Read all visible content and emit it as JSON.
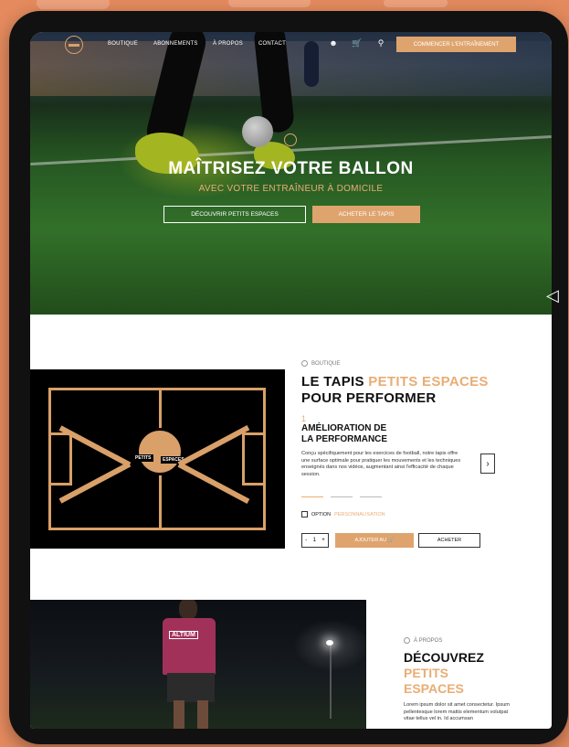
{
  "nav": {
    "links": [
      "BOUTIQUE",
      "ABONNEMENTS",
      "À PROPOS",
      "CONTACT"
    ],
    "cta": "COMMENCER L'ENTRAÎNEMENT",
    "icons": [
      "user-icon",
      "cart-icon",
      "search-icon"
    ]
  },
  "hero": {
    "title": "MAÎTRISEZ VOTRE BALLON",
    "subtitle": "AVEC VOTRE ENTRAÎNEUR À DOMICILE",
    "btn_discover": "DÉCOUVRIR PETITS ESPACES",
    "btn_buy": "ACHETER LE TAPIS"
  },
  "product": {
    "eyebrow": "BOUTIQUE",
    "title_part1": "LE TAPIS ",
    "title_accent": "PETITS ESPACES",
    "title_part2": "POUR PERFORMER",
    "feature_number": "1",
    "feature_title_line1": "AMÉLIORATION DE",
    "feature_title_line2": "LA PERFORMANCE",
    "feature_text": "Conçu spécifiquement pour les exercices de football, notre tapis offre une surface optimale pour pratiquer les mouvements et les techniques enseignés dans nos vidéos, augmentant ainsi l'efficacité de chaque session.",
    "option_label": "OPTION",
    "option_accent": "PERSONNALISATION",
    "quantity": "1",
    "add_label": "AJOUTER AU",
    "buy_label": "ACHETER",
    "mat_label_left": "PETITS",
    "mat_label_right": "ESPACES"
  },
  "about": {
    "eyebrow": "À PROPOS",
    "title": "DÉCOUVREZ",
    "accent_line1": "PETITS",
    "accent_line2": "ESPACES",
    "text": "Lorem ipsum dolor sit amet consectetur. Ipsum pellentesque lorem mattis elementum volutpat vitae tellus vel in. Id accumsan",
    "shirt_text": "ALTIUM"
  },
  "colors": {
    "accent": "#dfa46e",
    "background": "#e48a5e"
  }
}
